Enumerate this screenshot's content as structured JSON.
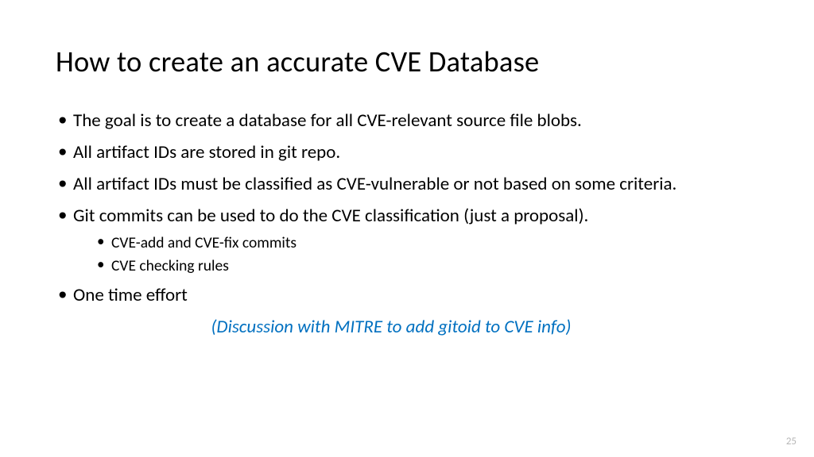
{
  "title": "How to create an accurate CVE Database",
  "bullets": [
    "The goal is to create a database for all CVE-relevant source file blobs.",
    "All artifact IDs are stored in git repo.",
    "All artifact IDs must be classified as CVE-vulnerable or not based on some criteria.",
    "Git commits can be used to do the CVE classification (just a proposal).",
    "One time effort"
  ],
  "sub_bullets": [
    "CVE-add and CVE-fix commits",
    "CVE checking rules"
  ],
  "discussion": "(Discussion with MITRE to add gitoid to CVE info)",
  "page_number": "25"
}
